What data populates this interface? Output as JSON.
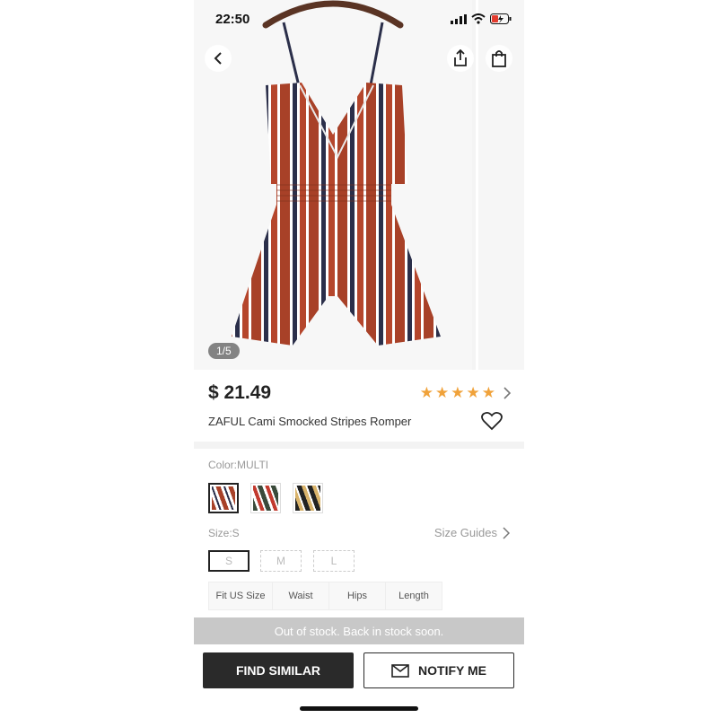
{
  "status": {
    "time": "22:50"
  },
  "gallery": {
    "counter": "1/5"
  },
  "product": {
    "price": "$ 21.49",
    "title": "ZAFUL Cami Smocked Stripes Romper",
    "rating_stars": 5
  },
  "color": {
    "label": "Color:MULTI",
    "swatches": [
      {
        "name": "multi",
        "selected": true
      },
      {
        "name": "green-red",
        "selected": false
      },
      {
        "name": "black-gold",
        "selected": false
      }
    ]
  },
  "size": {
    "label": "Size:S",
    "guide_label": "Size Guides",
    "options": [
      "S",
      "M",
      "L"
    ]
  },
  "size_table": {
    "headers": [
      "Fit US Size",
      "Waist",
      "Hips",
      "Length"
    ]
  },
  "stock_message": "Out of stock. Back in stock soon.",
  "actions": {
    "find_similar": "FIND SIMILAR",
    "notify_me": "NOTIFY ME"
  }
}
